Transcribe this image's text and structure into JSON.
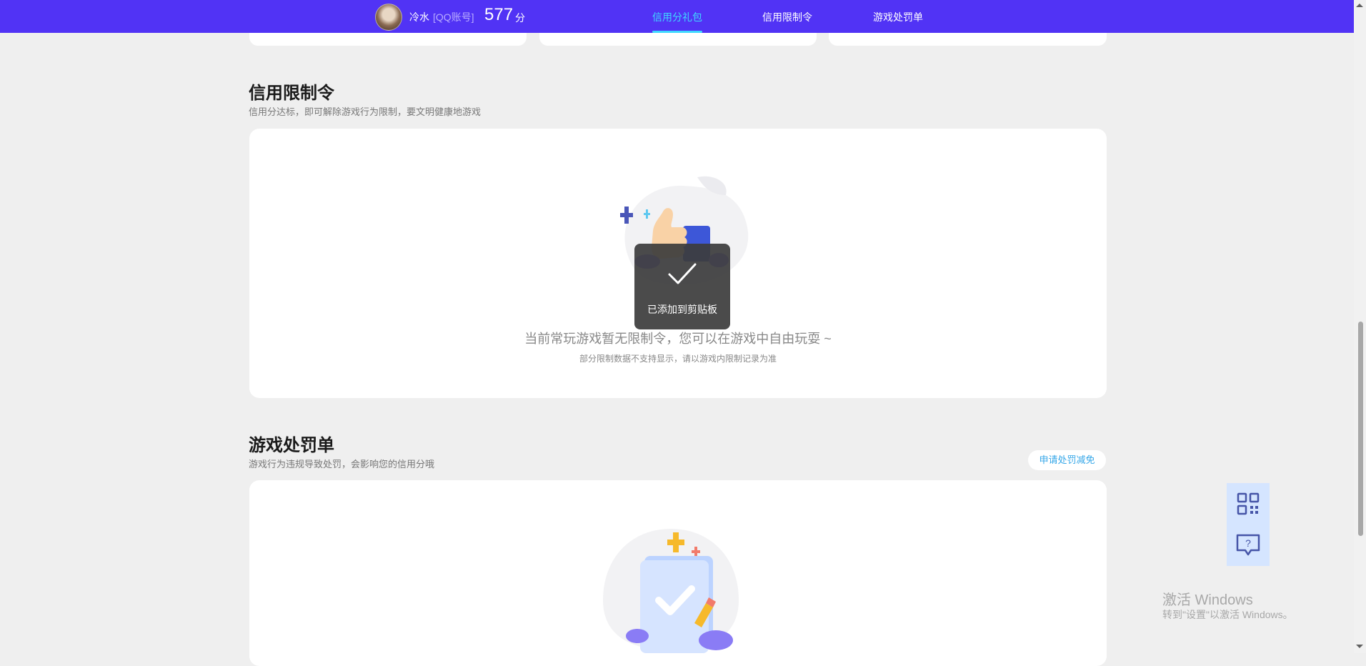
{
  "header": {
    "username": "冷水",
    "account_type": "[QQ账号]",
    "score": "577",
    "score_unit": "分",
    "nav": [
      {
        "label": "信用分礼包",
        "active": true
      },
      {
        "label": "信用限制令",
        "active": false
      },
      {
        "label": "游戏处罚单",
        "active": false
      }
    ]
  },
  "restriction_section": {
    "title": "信用限制令",
    "subtitle": "信用分达标，即可解除游戏行为限制，要文明健康地游戏",
    "empty_text": "当前常玩游戏暂无限制令，您可以在游戏中自由玩耍 ~",
    "empty_sub": "部分限制数据不支持显示，请以游戏内限制记录为准"
  },
  "penalty_section": {
    "title": "游戏处罚单",
    "subtitle": "游戏行为违规导致处罚，会影响您的信用分哦",
    "appeal_button": "申请处罚减免"
  },
  "toast": {
    "message": "已添加到剪贴板"
  },
  "watermark": {
    "line1": "激活 Windows",
    "line2": "转到\"设置\"以激活 Windows。"
  },
  "colors": {
    "header_bg": "#5133f5",
    "nav_active": "#3fd8ff",
    "link": "#33a6e8",
    "page_bg": "#efefef"
  }
}
